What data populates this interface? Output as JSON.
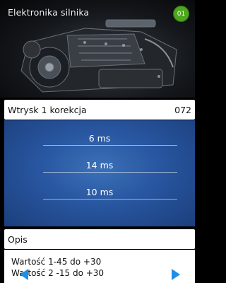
{
  "header": {
    "title": "Elektronika silnika",
    "badge": "01"
  },
  "parameter": {
    "name": "Wtrysk 1 korekcja",
    "code": "072",
    "values": [
      "6 ms",
      "14 ms",
      "10 ms"
    ]
  },
  "description": {
    "title": "Opis",
    "lines": [
      "Wartość 1-45 do +30",
      "Wartość 2 -15 do +30"
    ]
  },
  "navigation": {
    "prev_icon": "arrow-left-icon",
    "next_icon": "arrow-right-icon",
    "arrow_color": "#1e8fe8"
  },
  "colors": {
    "badge": "#4ea61e",
    "panel_blue": "#2856a0"
  }
}
